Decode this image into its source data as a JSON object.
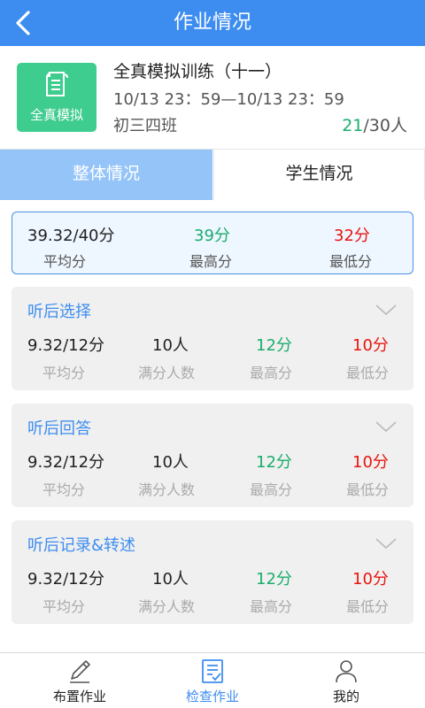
{
  "header": {
    "title": "作业情况",
    "back_icon": "back-arrow-icon"
  },
  "assignment": {
    "badge_label": "全真模拟",
    "badge_icon": "document-icon",
    "badge_color": "#3ecc8f",
    "name": "全真模拟训练（十一）",
    "time": "10/13 23：59—10/13 23：59",
    "class_name": "初三四班",
    "submitted": "21",
    "total": "/30人"
  },
  "tabs": [
    {
      "label": "整体情况",
      "active": true
    },
    {
      "label": "学生情况",
      "active": false
    }
  ],
  "overall": {
    "average": {
      "value": "39.32/40分",
      "label": "平均分"
    },
    "highest": {
      "value": "39分",
      "label": "最高分"
    },
    "lowest": {
      "value": "32分",
      "label": "最低分"
    }
  },
  "sections": [
    {
      "title": "听后选择",
      "average": "9.32/12分",
      "full_count": "10人",
      "highest": "12分",
      "lowest": "10分",
      "labels": {
        "average": "平均分",
        "full_count": "满分人数",
        "highest": "最高分",
        "lowest": "最低分"
      }
    },
    {
      "title": "听后回答",
      "average": "9.32/12分",
      "full_count": "10人",
      "highest": "12分",
      "lowest": "10分",
      "labels": {
        "average": "平均分",
        "full_count": "满分人数",
        "highest": "最高分",
        "lowest": "最低分"
      }
    },
    {
      "title": "听后记录&转述",
      "average": "9.32/12分",
      "full_count": "10人",
      "highest": "12分",
      "lowest": "10分",
      "labels": {
        "average": "平均分",
        "full_count": "满分人数",
        "highest": "最高分",
        "lowest": "最低分"
      }
    }
  ],
  "bottom_nav": [
    {
      "label": "布置作业",
      "icon": "pencil-icon",
      "active": false
    },
    {
      "label": "检查作业",
      "icon": "checklist-icon",
      "active": true
    },
    {
      "label": "我的",
      "icon": "user-icon",
      "active": false
    }
  ],
  "colors": {
    "primary": "#3d8df0",
    "tab_active": "#95c4f8",
    "green": "#1aad6c",
    "red": "#e8140f"
  }
}
